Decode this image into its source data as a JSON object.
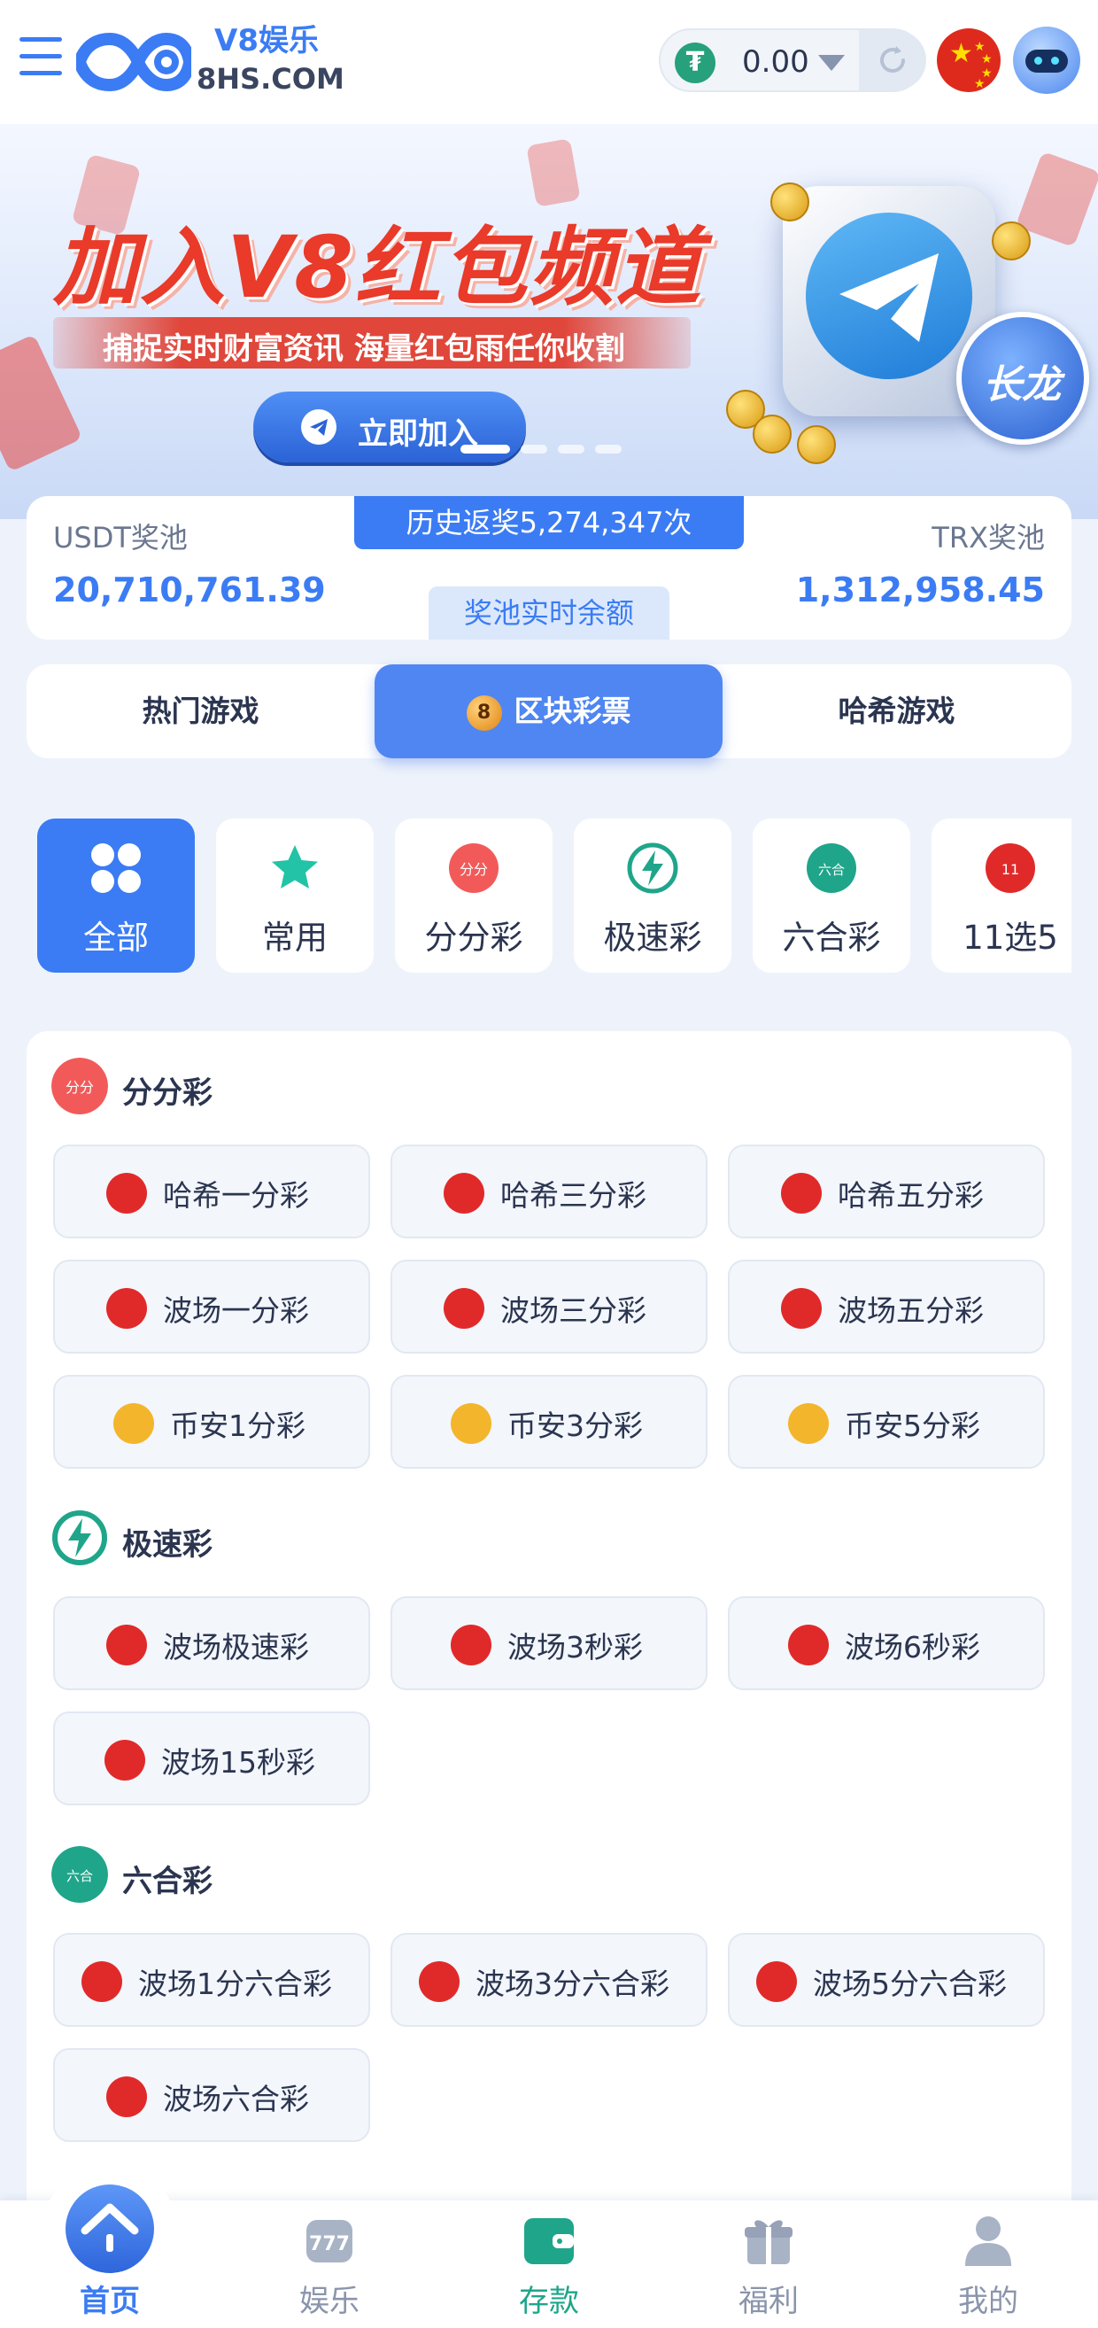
{
  "header": {
    "brand_title": "V8娱乐",
    "brand_domain": "8HS.COM",
    "balance": "0.00",
    "currency_icon": "usdt-icon",
    "language_icon": "china-flag-icon"
  },
  "banner": {
    "title": "加入V8红包频道",
    "subtitle": "捕捉实时财富资讯  海量红包雨任你收割",
    "cta_label": "立即加入",
    "badge": "长龙"
  },
  "jackpot": {
    "history": "历史返奖5,274,347次",
    "usdt_label": "USDT奖池",
    "usdt_amount": "20,710,761.39",
    "trx_label": "TRX奖池",
    "trx_amount": "1,312,958.45",
    "realtime_label": "奖池实时余额"
  },
  "game_tabs": [
    {
      "label": "热门游戏",
      "active": false
    },
    {
      "label": "区块彩票",
      "active": true,
      "badge": "8"
    },
    {
      "label": "哈希游戏",
      "active": false
    }
  ],
  "categories": [
    {
      "label": "全部",
      "icon": "grid-icon",
      "active": true
    },
    {
      "label": "常用",
      "icon": "star-icon",
      "active": false
    },
    {
      "label": "分分彩",
      "icon": "fenfencai-icon",
      "active": false
    },
    {
      "label": "极速彩",
      "icon": "lightning-icon",
      "active": false
    },
    {
      "label": "六合彩",
      "icon": "liuhecai-icon",
      "active": false
    },
    {
      "label": "11选5",
      "icon": "11x5-icon",
      "active": false
    }
  ],
  "sections": [
    {
      "title": "分分彩",
      "icon": "fenfencai-icon",
      "games": [
        {
          "name": "哈希一分彩",
          "icon": "tron-icon"
        },
        {
          "name": "哈希三分彩",
          "icon": "tron-icon"
        },
        {
          "name": "哈希五分彩",
          "icon": "tron-icon"
        },
        {
          "name": "波场一分彩",
          "icon": "tron-icon"
        },
        {
          "name": "波场三分彩",
          "icon": "tron-icon"
        },
        {
          "name": "波场五分彩",
          "icon": "tron-icon"
        },
        {
          "name": "币安1分彩",
          "icon": "bnb-icon"
        },
        {
          "name": "币安3分彩",
          "icon": "bnb-icon"
        },
        {
          "name": "币安5分彩",
          "icon": "bnb-icon"
        }
      ]
    },
    {
      "title": "极速彩",
      "icon": "lightning-icon",
      "games": [
        {
          "name": "波场极速彩",
          "icon": "tron-icon"
        },
        {
          "name": "波场3秒彩",
          "icon": "tron-icon"
        },
        {
          "name": "波场6秒彩",
          "icon": "tron-icon"
        },
        {
          "name": "波场15秒彩",
          "icon": "tron-icon"
        }
      ]
    },
    {
      "title": "六合彩",
      "icon": "liuhecai-icon",
      "games": [
        {
          "name": "波场1分六合彩",
          "icon": "tron-icon"
        },
        {
          "name": "波场3分六合彩",
          "icon": "tron-icon"
        },
        {
          "name": "波场5分六合彩",
          "icon": "tron-icon"
        },
        {
          "name": "波场六合彩",
          "icon": "tron-icon"
        }
      ]
    }
  ],
  "bottom_nav": [
    {
      "label": "首页",
      "icon": "home-icon",
      "active": true
    },
    {
      "label": "娱乐",
      "icon": "slot-machine-icon",
      "active": false
    },
    {
      "label": "存款",
      "icon": "wallet-icon",
      "active": false
    },
    {
      "label": "福利",
      "icon": "gift-icon",
      "active": false
    },
    {
      "label": "我的",
      "icon": "user-icon",
      "active": false
    }
  ],
  "colors": {
    "primary": "#3b7cf4",
    "tron_red": "#e02a2a",
    "bnb_gold": "#f3b52c",
    "deposit_green": "#1fa58a"
  }
}
